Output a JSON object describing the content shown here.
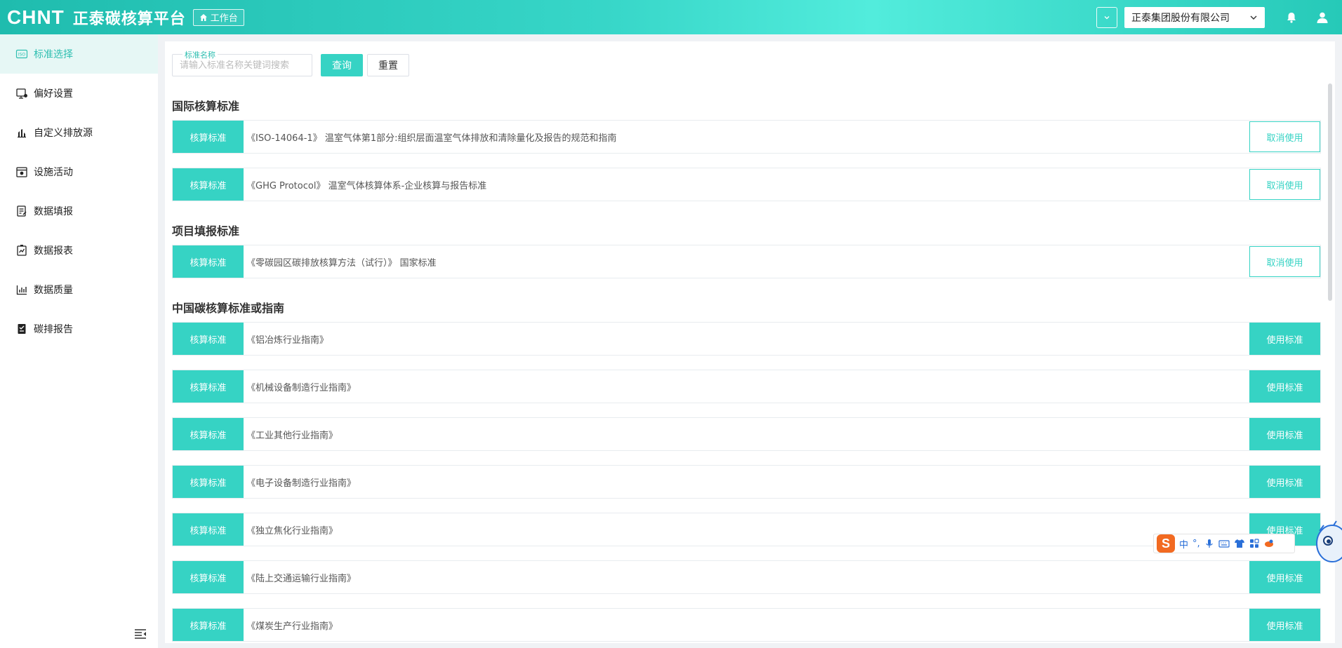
{
  "header": {
    "logo": "CHNT",
    "app_title": "正泰碳核算平台",
    "workbench_label": "工作台",
    "company": "正泰集团股份有限公司"
  },
  "sidebar": {
    "items": [
      {
        "label": "标准选择",
        "icon": "iso-icon",
        "active": true
      },
      {
        "label": "偏好设置",
        "icon": "preference-icon",
        "active": false
      },
      {
        "label": "自定义排放源",
        "icon": "emission-source-icon",
        "active": false
      },
      {
        "label": "设施活动",
        "icon": "facility-icon",
        "active": false
      },
      {
        "label": "数据填报",
        "icon": "form-icon",
        "active": false
      },
      {
        "label": "数据报表",
        "icon": "report-chart-icon",
        "active": false
      },
      {
        "label": "数据质量",
        "icon": "bar-chart-icon",
        "active": false
      },
      {
        "label": "碳排报告",
        "icon": "document-icon",
        "active": false
      }
    ]
  },
  "search": {
    "label": "标准名称",
    "placeholder": "请输入标准名称关键词搜索",
    "query_button": "查询",
    "reset_button": "重置"
  },
  "sections": [
    {
      "title": "国际核算标准",
      "rows": [
        {
          "tag": "核算标准",
          "name": "《ISO-14064-1》  温室气体第1部分:组织层面温室气体排放和清除量化及报告的规范和指南",
          "action": "取消使用",
          "action_type": "cancel"
        },
        {
          "tag": "核算标准",
          "name": "《GHG Protocol》  温室气体核算体系-企业核算与报告标准",
          "action": "取消使用",
          "action_type": "cancel"
        }
      ]
    },
    {
      "title": "项目填报标准",
      "rows": [
        {
          "tag": "核算标准",
          "name": "《零碳园区碳排放核算方法（试行）》  国家标准",
          "action": "取消使用",
          "action_type": "cancel"
        }
      ]
    },
    {
      "title": "中国碳核算标准或指南",
      "rows": [
        {
          "tag": "核算标准",
          "name": "《铝冶炼行业指南》",
          "action": "使用标准",
          "action_type": "use"
        },
        {
          "tag": "核算标准",
          "name": "《机械设备制造行业指南》",
          "action": "使用标准",
          "action_type": "use"
        },
        {
          "tag": "核算标准",
          "name": "《工业其他行业指南》",
          "action": "使用标准",
          "action_type": "use"
        },
        {
          "tag": "核算标准",
          "name": "《电子设备制造行业指南》",
          "action": "使用标准",
          "action_type": "use"
        },
        {
          "tag": "核算标准",
          "name": "《独立焦化行业指南》",
          "action": "使用标准",
          "action_type": "use"
        },
        {
          "tag": "核算标准",
          "name": "《陆上交通运输行业指南》",
          "action": "使用标准",
          "action_type": "use"
        },
        {
          "tag": "核算标准",
          "name": "《煤炭生产行业指南》",
          "action": "使用标准",
          "action_type": "use"
        }
      ]
    }
  ],
  "ime": {
    "logo": "S",
    "mode": "中",
    "punct": "°,"
  },
  "colors": {
    "accent": "#36d3c4",
    "header_gradient_start": "#1fbcae",
    "header_gradient_mid": "#52ecdc",
    "active_nav_bg": "#e6f7f5"
  }
}
